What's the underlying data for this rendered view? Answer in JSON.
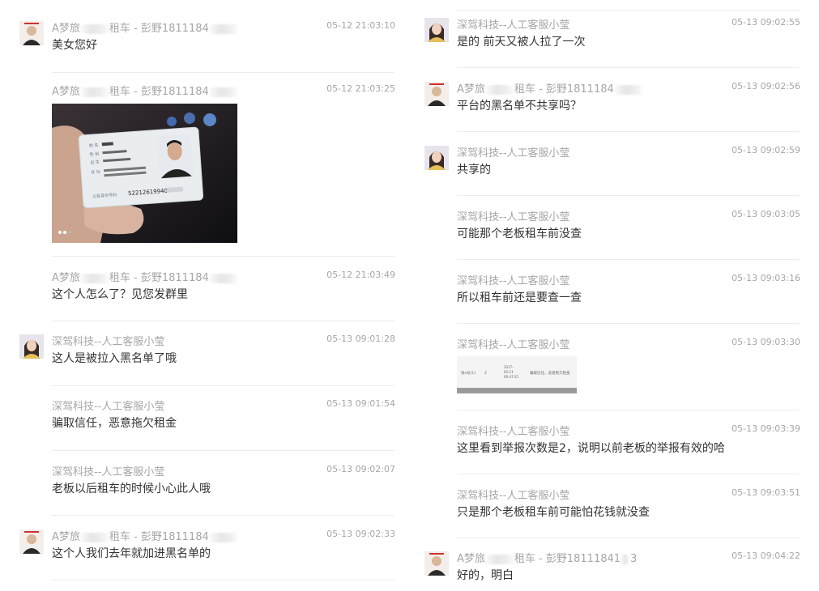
{
  "senders": {
    "customer": "A梦旅 租车 - 彭野1811184 ",
    "customer_short": "A梦旅 租车 - 彭野1811184",
    "support": "深驾科技--人工客服小莹",
    "customer_alt": "A梦旅 租车 - 彭野18111841 3"
  },
  "left_messages": [
    {
      "sender": "A梦旅",
      "sender2": "租车 - 彭野1811184",
      "time": "05-12 21:03:10",
      "text": "美女您好"
    },
    {
      "sender": "A梦旅",
      "sender2": "租车 - 彭野1811184",
      "time": "05-12 21:03:25",
      "text": ""
    },
    {
      "sender": "A梦旅",
      "sender2": "租车 - 彭野1811184",
      "time": "05-12 21:03:49",
      "text": "这个人怎么了？见您发群里"
    },
    {
      "sender": "深驾科技--人工客服小莹",
      "time": "05-13 09:01:28",
      "text": "这人是被拉入黑名单了哦"
    },
    {
      "sender": "深驾科技--人工客服小莹",
      "time": "05-13 09:01:54",
      "text": "骗取信任，恶意拖欠租金"
    },
    {
      "sender": "深驾科技--人工客服小莹",
      "time": "05-13 09:02:07",
      "text": "老板以后租车的时候小心此人哦"
    },
    {
      "sender": "A梦旅",
      "sender2": "租车 - 彭野1811184",
      "time": "05-13 09:02:33",
      "text": "这个人我们去年就加进黑名单的"
    }
  ],
  "right_messages": [
    {
      "sender": "深驾科技--人工客服小莹",
      "time": "05-13 09:02:55",
      "text": "是的 前天又被人拉了一次"
    },
    {
      "sender": "A梦旅",
      "sender2": "租车 - 彭野1811184",
      "time": "05-13 09:02:56",
      "text": "平台的黑名单不共享吗？"
    },
    {
      "sender": "深驾科技--人工客服小莹",
      "time": "05-13 09:02:59",
      "text": "共享的"
    },
    {
      "sender": "深驾科技--人工客服小莹",
      "time": "05-13 09:03:05",
      "text": "可能那个老板租车前没查"
    },
    {
      "sender": "深驾科技--人工客服小莹",
      "time": "05-13 09:03:16",
      "text": "所以租车前还是要查一查"
    },
    {
      "sender": "深驾科技--人工客服小莹",
      "time": "05-13 09:03:30",
      "text": ""
    },
    {
      "sender": "深驾科技--人工客服小莹",
      "time": "05-13 09:03:39",
      "text": "这里看到举报次数是2，说明以前老板的举报有效的哈"
    },
    {
      "sender": "深驾科技--人工客服小莹",
      "time": "05-13 09:03:51",
      "text": "只是那个老板租车前可能怕花钱就没查"
    },
    {
      "sender": "A梦旅",
      "sender2": "租车 - 彭野18111841",
      "sender3": "3",
      "time": "05-13 09:04:22",
      "text": "好的，明白"
    }
  ],
  "image_screenshot": {
    "col1": "张x号(1)",
    "col2": "2",
    "col3a": "2017-",
    "col3b": "05-11",
    "col3c": "09:47:55",
    "col4": "骗取信任，恶意拖欠租金"
  },
  "id_card": {
    "name_label": "姓 名",
    "sex_label": "性 别",
    "birth_label": "出 生",
    "addr_label": "住 址",
    "id_label": "公民身份号码",
    "id_number": "52212619940"
  },
  "colors": {
    "meta_gray": "#a6a6a6",
    "text": "#333333",
    "divider": "#ececec"
  }
}
